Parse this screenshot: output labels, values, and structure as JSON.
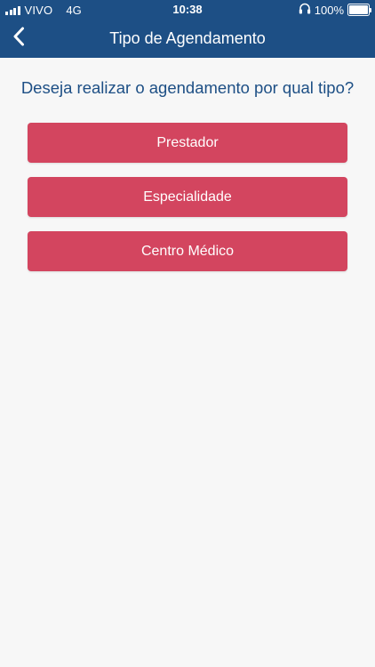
{
  "status_bar": {
    "carrier": "VIVO",
    "network": "4G",
    "time": "10:38",
    "battery": "100%",
    "battery_level": 1.0,
    "icons": [
      "signal-icon",
      "headphones-icon",
      "battery-icon"
    ]
  },
  "header": {
    "title": "Tipo de Agendamento",
    "back_icon": "chevron-left-icon"
  },
  "main": {
    "question": "Deseja realizar o agendamento por qual tipo?",
    "options": [
      {
        "label": "Prestador"
      },
      {
        "label": "Especialidade"
      },
      {
        "label": "Centro Médico"
      }
    ]
  },
  "colors": {
    "header_bg": "#1d4f85",
    "question_text": "#1d4f85",
    "button_bg": "#d3455f",
    "page_bg": "#f7f7f7"
  }
}
